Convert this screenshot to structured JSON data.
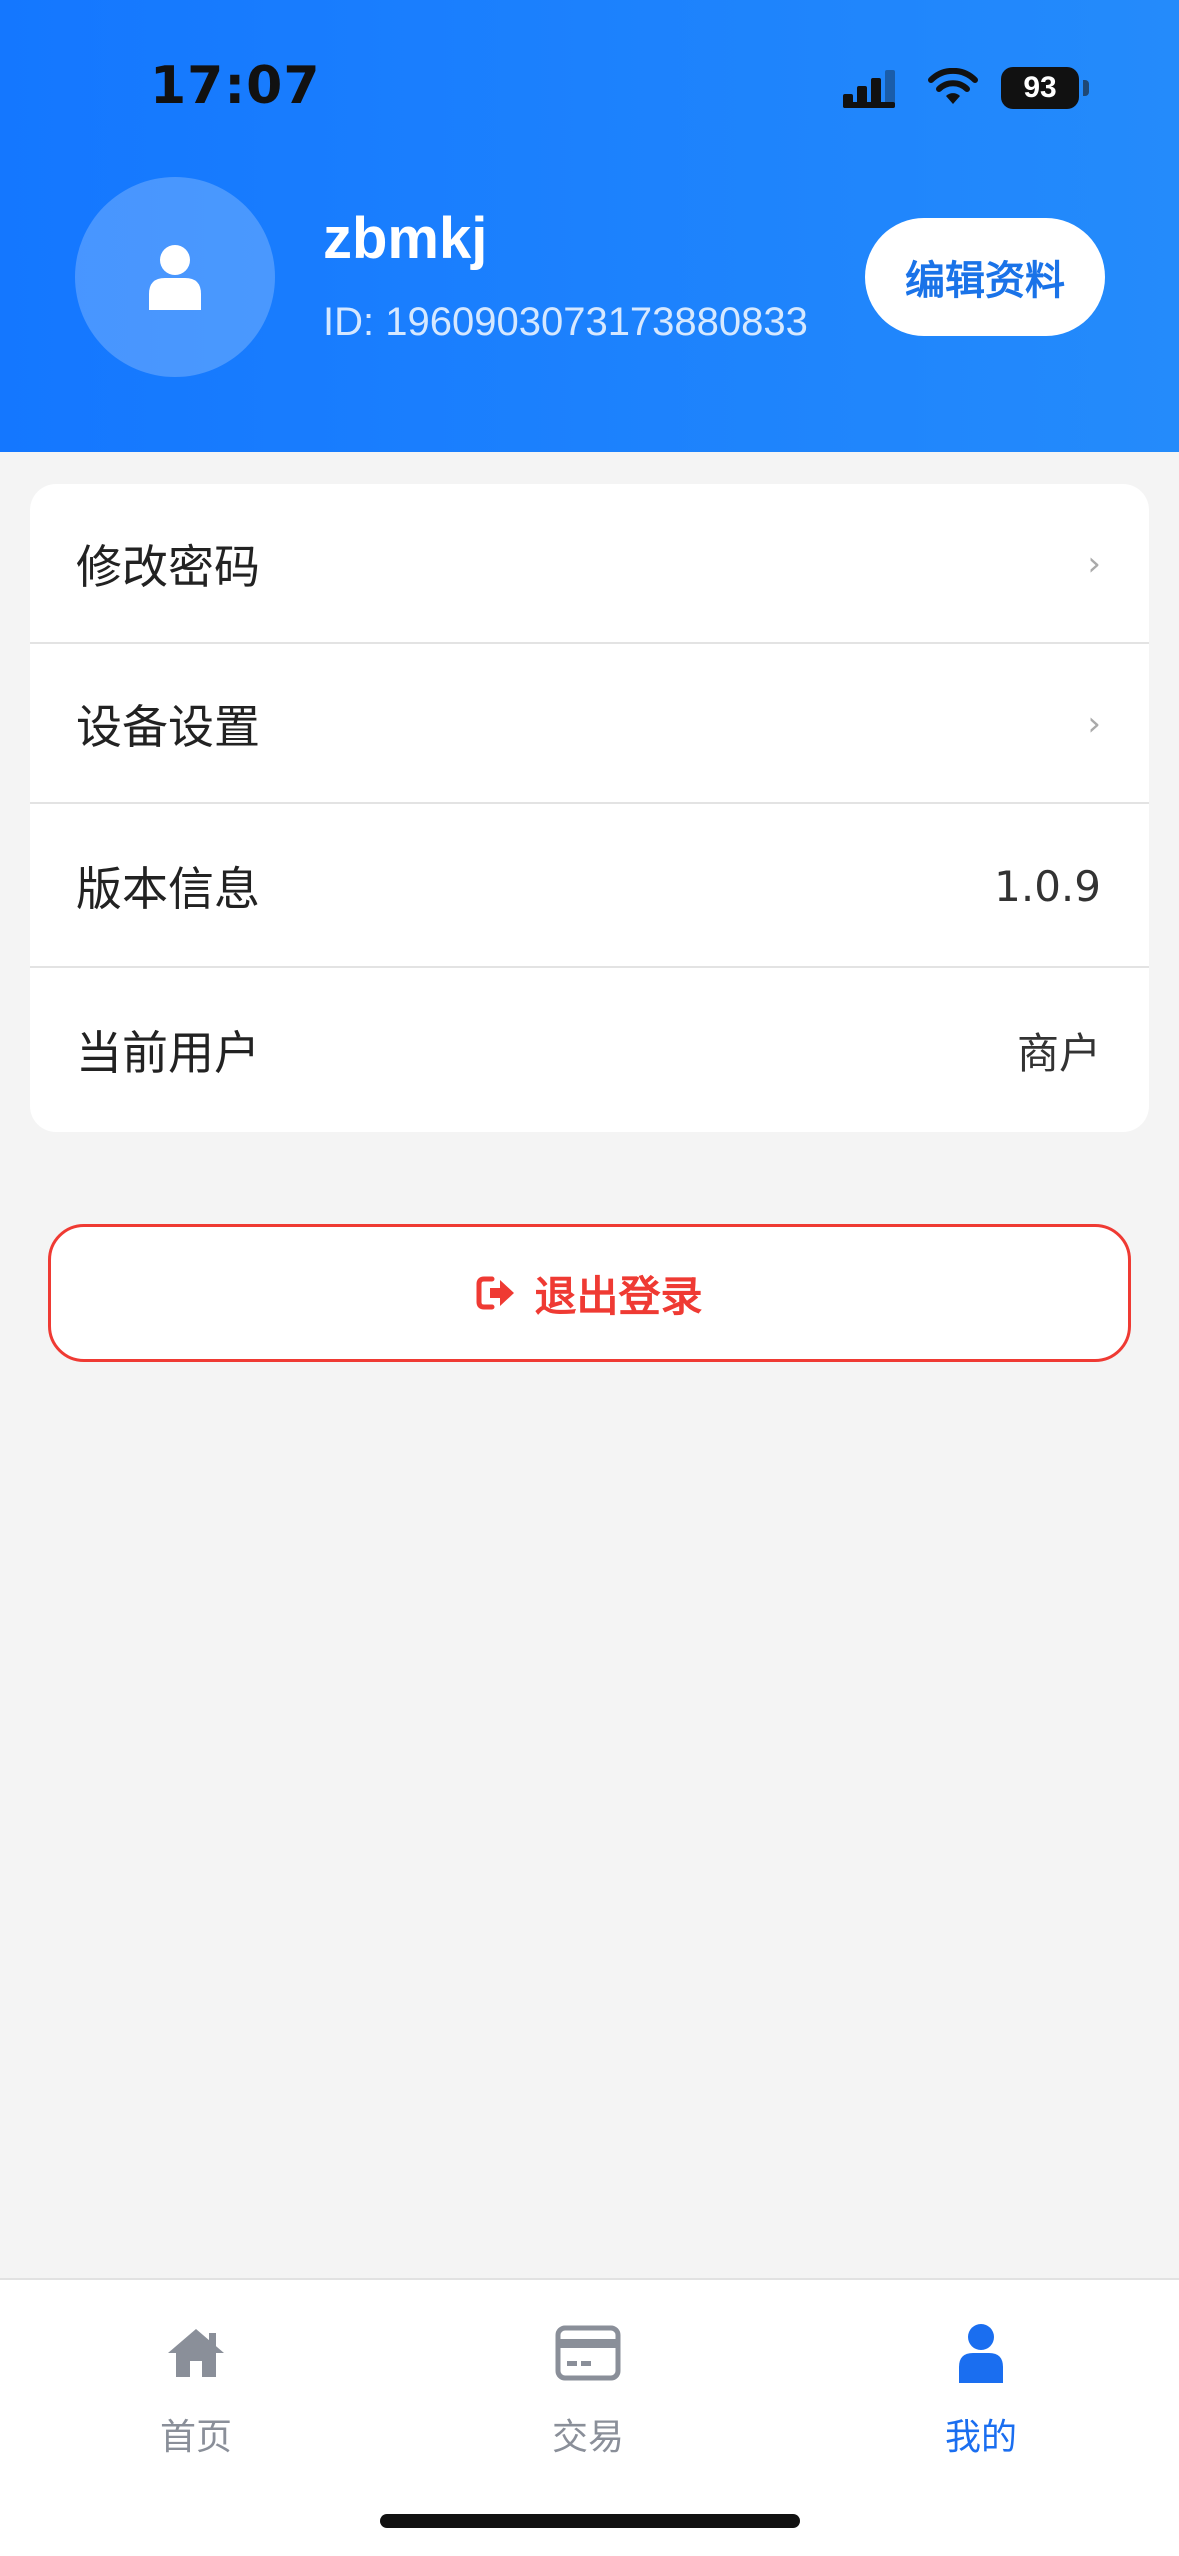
{
  "status_bar": {
    "time": "17:07",
    "battery": "93"
  },
  "profile": {
    "username": "zbmkj",
    "user_id": "ID: 1960903073173880833",
    "edit_label": "编辑资料"
  },
  "menu": {
    "change_password": "修改密码",
    "device_settings": "设备设置",
    "version_label": "版本信息",
    "version_value": "1.0.9",
    "current_user_label": "当前用户",
    "current_user_value": "商户",
    "chevron": "›"
  },
  "logout": {
    "label": "退出登录"
  },
  "tabbar": {
    "tabs": [
      {
        "label": "首页",
        "icon": "home-icon",
        "active": false
      },
      {
        "label": "交易",
        "icon": "card-icon",
        "active": false
      },
      {
        "label": "我的",
        "icon": "user-icon",
        "active": true
      }
    ]
  },
  "colors": {
    "header_blue": "#1477ff",
    "accent_blue": "#1a6ef0",
    "logout_red": "#ef3a33",
    "inactive_gray": "#8a8f99"
  }
}
